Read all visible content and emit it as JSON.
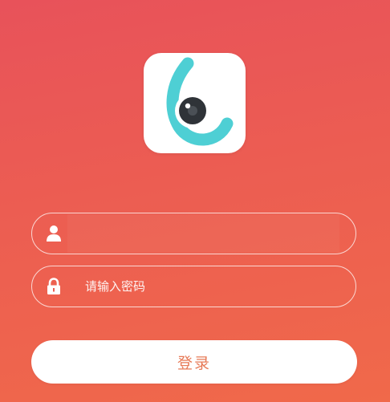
{
  "logo": {
    "icon": "camera-logo-icon",
    "colors": {
      "ring": "#4ecfd4",
      "lens": "#2f3338",
      "background": "#ffffff"
    }
  },
  "login_form": {
    "username": {
      "icon": "user-icon",
      "value": "",
      "placeholder": ""
    },
    "password": {
      "icon": "lock-icon",
      "value": "",
      "placeholder": "请输入密码"
    },
    "submit_label": "登录"
  },
  "theme": {
    "gradient_start": "#e8525a",
    "gradient_end": "#f0694a",
    "button_text": "#e77a57"
  }
}
